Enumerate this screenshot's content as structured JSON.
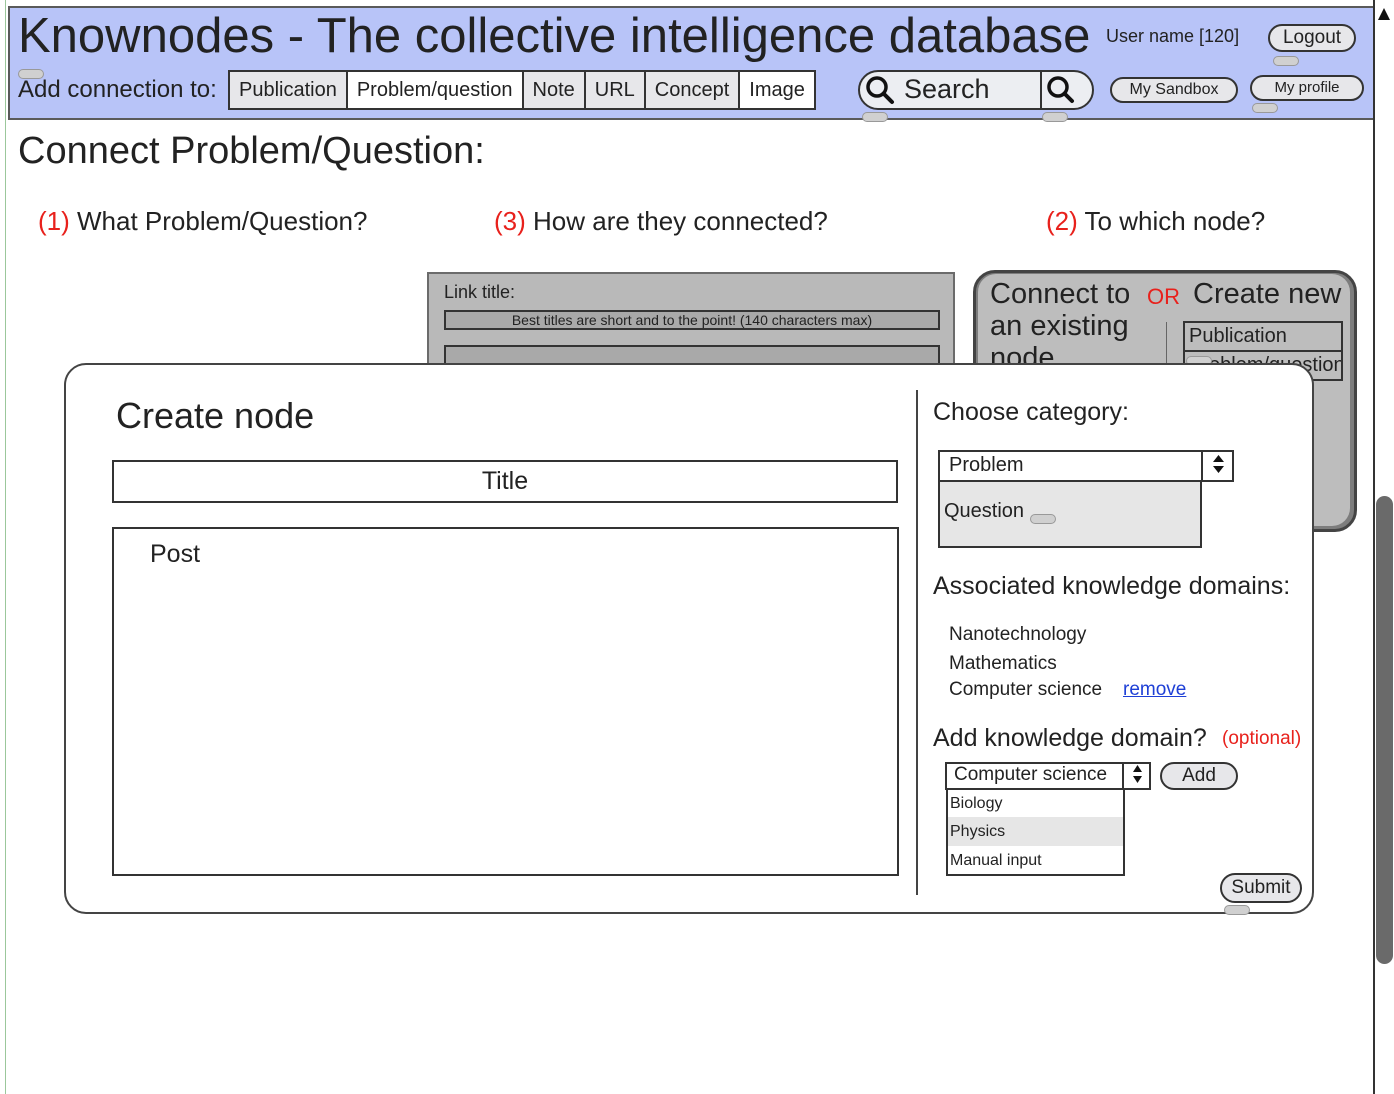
{
  "header": {
    "app_title": "Knownodes - The collective intelligence database",
    "user_name": "User name [120]",
    "logout_label": "Logout",
    "add_connection_label": "Add connection to:",
    "types": [
      "Publication",
      "Problem/question",
      "Note",
      "URL",
      "Concept",
      "Image"
    ],
    "search_label": "Search",
    "my_sandbox_label": "My Sandbox",
    "my_profile_label": "My profile"
  },
  "page": {
    "section_title": "Connect Problem/Question:",
    "steps": [
      {
        "num": "(1)",
        "label": " What Problem/Question?"
      },
      {
        "num": "(3)",
        "label": " How are they connected?"
      },
      {
        "num": "(2)",
        "label": " To which node?"
      }
    ]
  },
  "link_panel": {
    "link_title_label": "Link title:",
    "link_title_placeholder": "Best titles are short and to the point! (140 characters max)"
  },
  "connect_panel": {
    "connect_existing": "Connect to an existing node",
    "or_label": "OR",
    "create_new": "Create new",
    "list": [
      "Publication",
      "Problem/question"
    ]
  },
  "modal": {
    "title": "Create node",
    "title_field": "Title",
    "post_field": "Post",
    "choose_category_label": "Choose category:",
    "category_selected": "Problem",
    "category_option": "Question",
    "associated_label": "Associated knowledge domains:",
    "domains": [
      "Nanotechnology",
      "Mathematics",
      "Computer science"
    ],
    "remove_label": "remove",
    "add_domain_label": "Add knowledge domain?",
    "optional_label": "(optional)",
    "domain_selected": "Computer science",
    "domain_options": [
      "Biology",
      "Physics",
      "Manual input"
    ],
    "add_label": "Add",
    "submit_label": "Submit"
  },
  "colors": {
    "header_bg": "#b8c4f8",
    "accent_red": "#e8211c",
    "link_blue": "#1e3fd6"
  }
}
